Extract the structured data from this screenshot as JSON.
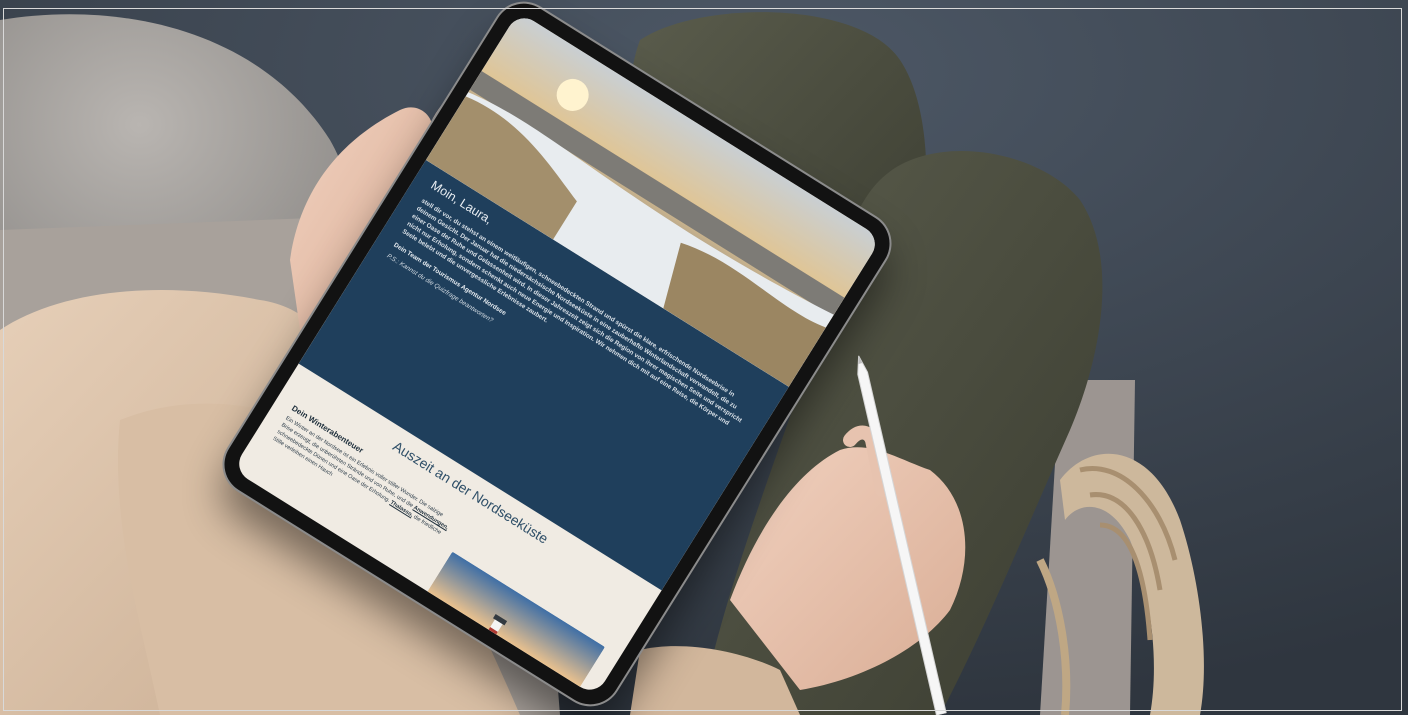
{
  "email": {
    "greeting": "Moin, Laura,",
    "body": "stell dir vor, du stehst an einem weitläufigen, schneebedeckten Strand und spürst die klare, erfrischende Nordseebrise in deinem Gesicht. Der Januar hat die niedersächsische Nordseeküste in eine zauberhafte Winterlandschaft verwandelt, die zu einer Oase der Ruhe und Gelassenheit wird. In dieser Jahreszeit zeigt sich die Region von ihrer magischen Seite und verspricht nicht nur Erholung, sondern schenkt auch neue Energie und Inspiration. Wir nehmen dich mit auf eine Reise, die Körper und Seele belebt und die unvergessliche Erlebnisse zaubert.",
    "signature": "Dein Team der Tourismus Agentur Nordsee",
    "ps": "P.S.: Kannst du die Quizfrage beantworten?",
    "section_title": "Auszeit an der Nordseeküste",
    "subheading": "Dein Winterabenteuer",
    "text_before_link1": "Ein Winter an der Nordsee ist ein Erlebnis voller stiller Wunder. Die salzige Brise erzeugt, die unberührten Strände und von Ruhe, und die",
    "link1": "Anwendungen,",
    "text_between": "schneebedeckte Dünen und eine Oase der Erholung.",
    "link2": "Thalasso,",
    "text_after_link2": "die friedliche Stille verleihen einen Hauch"
  },
  "colors": {
    "email_header_bg": "#1f3f5c",
    "email_body_bg": "#f0ebe3",
    "tablet_bezel": "#121212"
  }
}
